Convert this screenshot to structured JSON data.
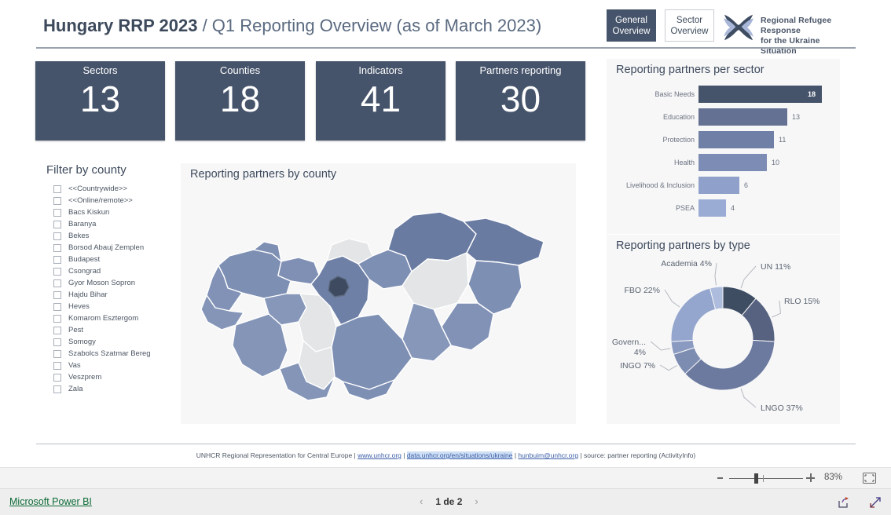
{
  "header": {
    "title_bold": "Hungary RRP 2023",
    "title_rest": " / Q1 Reporting Overview (as of March 2023)",
    "nav_active": "General Overview",
    "nav_inactive": "Sector Overview",
    "logo_line1": "Regional Refugee Response",
    "logo_line2": "for the Ukraine Situation"
  },
  "kpis": [
    {
      "label": "Sectors",
      "value": "13"
    },
    {
      "label": "Counties",
      "value": "18"
    },
    {
      "label": "Indicators",
      "value": "41"
    },
    {
      "label": "Partners reporting",
      "value": "30"
    }
  ],
  "filter": {
    "title": "Filter by county",
    "items": [
      "<<Countrywide>>",
      "<<Online/remote>>",
      "Bacs Kiskun",
      "Baranya",
      "Bekes",
      "Borsod Abauj Zemplen",
      "Budapest",
      "Csongrad",
      "Gyor Moson Sopron",
      "Hajdu Bihar",
      "Heves",
      "Komarom Esztergom",
      "Pest",
      "Somogy",
      "Szabolcs Szatmar Bereg",
      "Vas",
      "Veszprem",
      "Zala"
    ]
  },
  "map_panel": {
    "title": "Reporting partners by county"
  },
  "bar_panel": {
    "title": "Reporting partners per sector"
  },
  "donut_panel": {
    "title": "Reporting partners by type"
  },
  "footer": {
    "prefix": "UNHCR Regional Representation for Central Europe",
    "sep": " | ",
    "link1": "www.unhcr.org",
    "link2": "data.unhcr.org/en/situations/ukraine",
    "link3": "hunbuim@unhcr.org",
    "suffix": "source: partner reporting (ActivityInfo)"
  },
  "zoombar": {
    "percent": "83%"
  },
  "statusbar": {
    "brand": "Microsoft Power BI",
    "page_indicator": "1 de 2",
    "prev": "‹",
    "next": "›"
  },
  "chart_data": [
    {
      "type": "bar",
      "title": "Reporting partners per sector",
      "orientation": "horizontal",
      "categories": [
        "Basic Needs",
        "Education",
        "Protection",
        "Health",
        "Livelihood & Inclusion",
        "PSEA"
      ],
      "values": [
        18,
        13,
        11,
        10,
        6,
        4
      ],
      "colors": [
        "#46546b",
        "#647193",
        "#6f7fa6",
        "#7d8cb4",
        "#8fa0ca",
        "#9aabd4"
      ],
      "xlabel": "",
      "ylabel": "",
      "xlim": [
        0,
        18
      ],
      "grid": false,
      "legend": "none",
      "labels_shown": true
    },
    {
      "type": "pie",
      "subtype": "donut",
      "title": "Reporting partners by type",
      "labels": [
        "UN",
        "RLO",
        "LNGO",
        "INGO",
        "Govern...",
        "FBO",
        "Academia"
      ],
      "values": [
        11,
        15,
        37,
        7,
        4,
        22,
        4
      ],
      "value_labels": [
        "UN 11%",
        "RLO 15%",
        "LNGO 37%",
        "INGO 7%",
        "Govern... 4%",
        "FBO 22%",
        "Academia 4%"
      ],
      "colors": [
        "#3f4d63",
        "#56627f",
        "#6b7a9e",
        "#7d8cb1",
        "#8b9ac0",
        "#94a6cd",
        "#adbbdd"
      ],
      "legend": "labels-outside",
      "units": "percent"
    },
    {
      "type": "map",
      "subtype": "choropleth",
      "title": "Reporting partners by county",
      "region": "Hungary",
      "legend": "none",
      "note": "County shading from light grey (no partners) to dark blue (most partners); Budapest highlighted darkest."
    }
  ]
}
